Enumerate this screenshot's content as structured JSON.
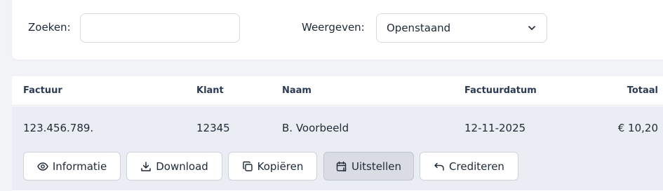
{
  "filters": {
    "search_label": "Zoeken:",
    "search_value": "",
    "view_label": "Weergeven:",
    "view_selected": "Openstaand"
  },
  "table": {
    "headers": {
      "invoice": "Factuur",
      "client": "Klant",
      "name": "Naam",
      "date": "Factuurdatum",
      "total": "Totaal"
    },
    "rows": [
      {
        "invoice": "123.456.789.",
        "client": "12345",
        "name": "B. Voorbeeld",
        "date": "12-11-2025",
        "total": "€ 10,20"
      }
    ]
  },
  "actions": {
    "info_label": "Informatie",
    "download_label": "Download",
    "copy_label": "Kopiëren",
    "postpone_label": "Uitstellen",
    "credit_label": "Crediteren"
  },
  "icons": {
    "info": "eye-icon",
    "download": "download-icon",
    "copy": "copy-icon",
    "postpone": "calendar-pause-icon",
    "credit": "undo-arrow-icon",
    "select": "chevron-down-icon"
  },
  "colors": {
    "header_text": "#2b3a55",
    "row_background": "#eaeef4",
    "active_button": "#d9dde3"
  }
}
